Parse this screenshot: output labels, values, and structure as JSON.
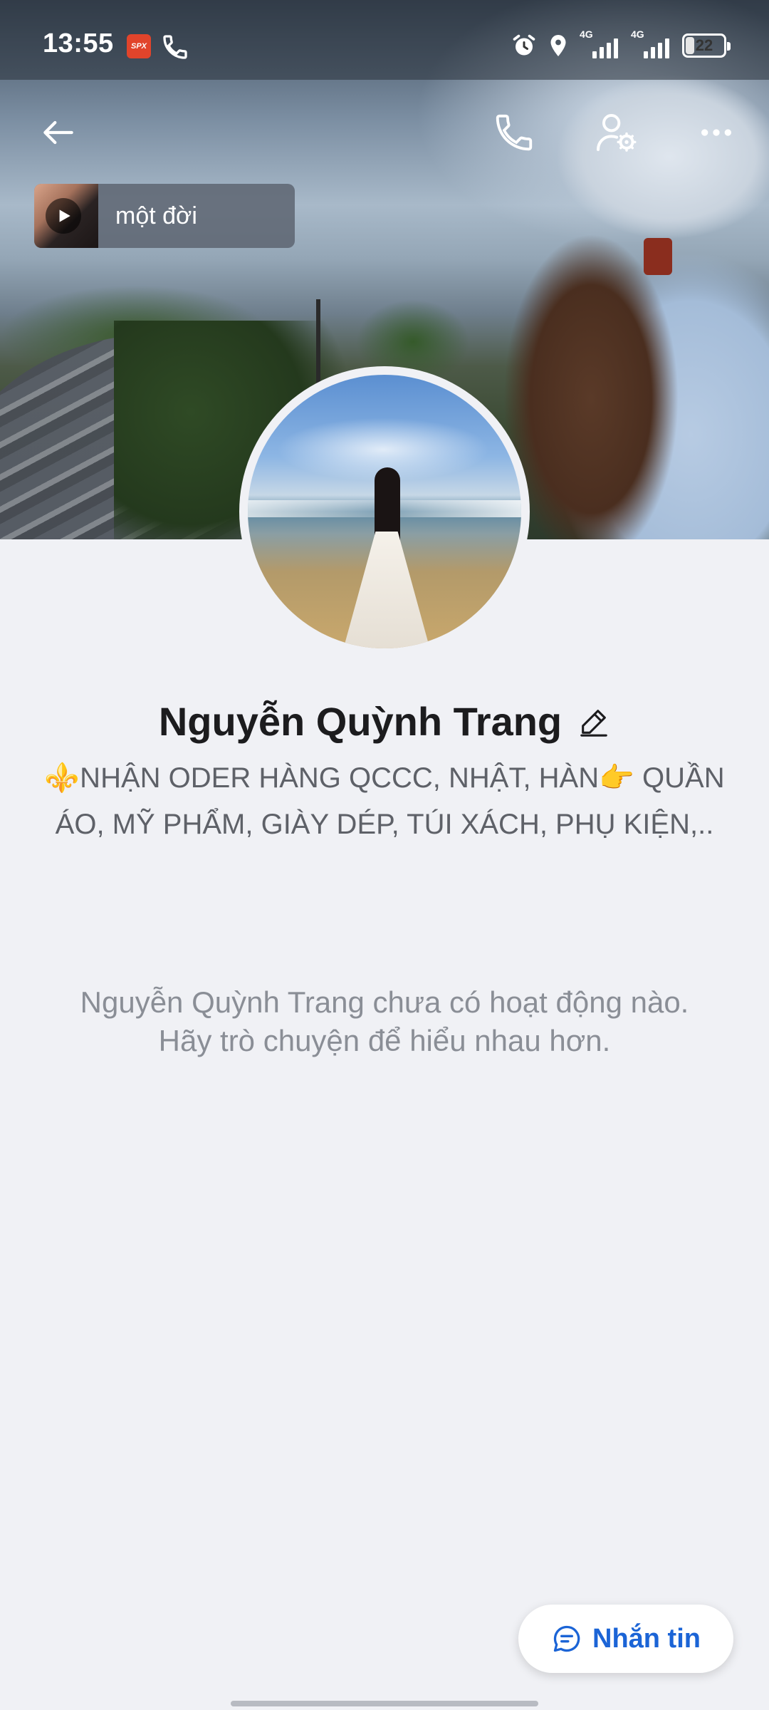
{
  "status_bar": {
    "time": "13:55",
    "spx_label": "SPX",
    "network1": "4G",
    "network2": "4G",
    "battery": "22"
  },
  "music": {
    "title": "một đời"
  },
  "profile": {
    "name": "Nguyễn Quỳnh Trang",
    "bio": "⚜️NHẬN ODER HÀNG QCCC, NHẬT, HÀN👉 QUẦN ÁO, MỸ PHẨM, GIÀY DÉP, TÚI XÁCH, PHỤ KIỆN,..",
    "empty_activity": "Nguyễn Quỳnh Trang chưa có hoạt động nào. Hãy trò chuyện để hiểu nhau hơn."
  },
  "actions": {
    "message_label": "Nhắn tin"
  },
  "icons": {
    "back": "arrow-left-icon",
    "call": "phone-icon",
    "settings": "user-settings-icon",
    "more": "more-horizontal-icon",
    "edit": "pencil-icon",
    "message": "chat-bubble-icon",
    "play": "play-icon"
  },
  "colors": {
    "accent": "#1b64d6",
    "background": "#f0f1f5"
  }
}
